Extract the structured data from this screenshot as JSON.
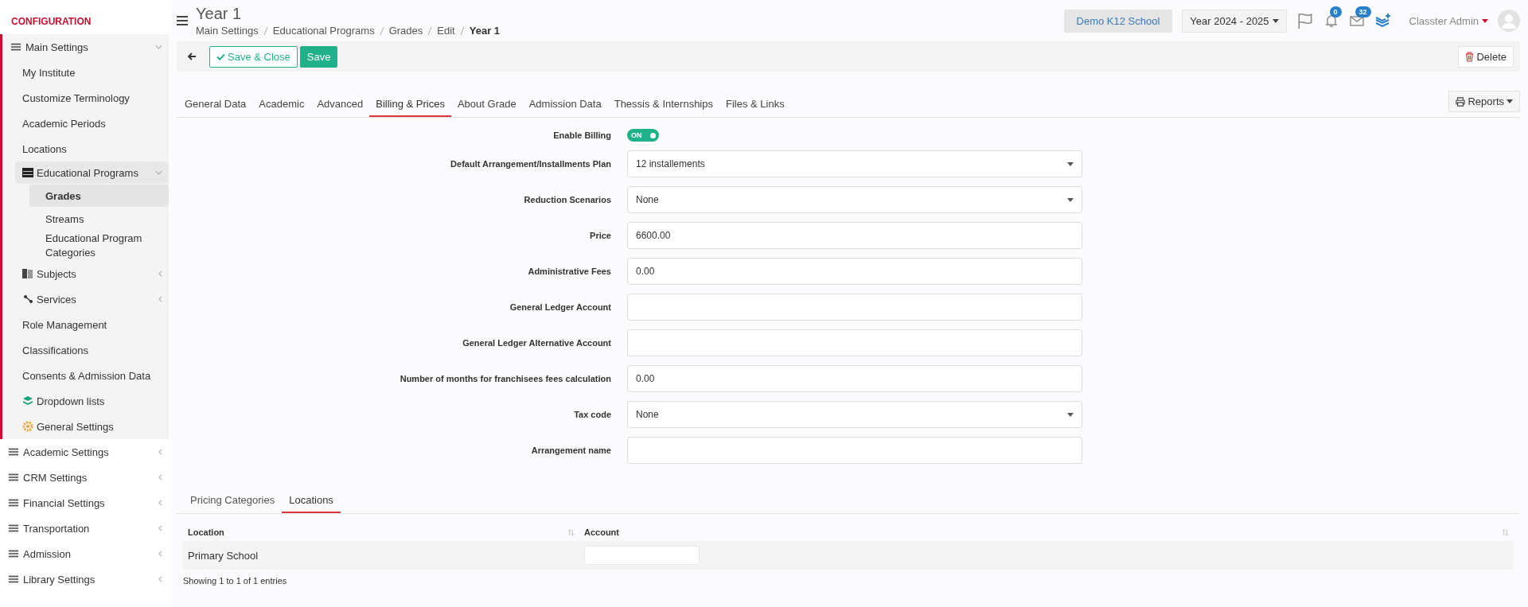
{
  "sidebar": {
    "heading": "CONFIGURATION",
    "items": [
      {
        "label": "Main Settings",
        "expanded": true,
        "selected": false,
        "children": [
          {
            "label": "My Institute",
            "selected": false
          },
          {
            "label": "Customize Terminology",
            "selected": false
          },
          {
            "label": "Academic Periods",
            "selected": false
          },
          {
            "label": "Locations",
            "selected": false
          },
          {
            "label": "Educational Programs",
            "expanded": true,
            "selected": false,
            "children": [
              {
                "label": "Grades",
                "selected": true
              },
              {
                "label": "Streams",
                "selected": false
              },
              {
                "label": "Educational Program Categories",
                "selected": false
              }
            ]
          },
          {
            "label": "Subjects",
            "expanded": false,
            "selected": false
          },
          {
            "label": "Services",
            "expanded": false,
            "selected": false
          },
          {
            "label": "Role Management",
            "selected": false
          },
          {
            "label": "Classifications",
            "selected": false
          },
          {
            "label": "Consents & Admission Data",
            "selected": false
          },
          {
            "label": "Dropdown lists",
            "selected": false
          },
          {
            "label": "General Settings",
            "selected": false
          }
        ]
      },
      {
        "label": "Academic Settings",
        "expanded": false,
        "selected": false
      },
      {
        "label": "CRM Settings",
        "expanded": false,
        "selected": false
      },
      {
        "label": "Financial Settings",
        "expanded": false,
        "selected": false
      },
      {
        "label": "Transportation",
        "expanded": false,
        "selected": false
      },
      {
        "label": "Admission",
        "expanded": false,
        "selected": false
      },
      {
        "label": "Library Settings",
        "expanded": false,
        "selected": false
      }
    ]
  },
  "header": {
    "title": "Year 1",
    "breadcrumbs": [
      "Main Settings",
      "Educational Programs",
      "Grades",
      "Edit",
      "Year 1"
    ],
    "school": "Demo K12 School",
    "year": "Year 2024 - 2025",
    "notifications": "0",
    "messages": "32",
    "user": "Classter Admin"
  },
  "toolbar": {
    "save_close": "Save & Close",
    "save": "Save",
    "delete": "Delete"
  },
  "tabs": [
    {
      "label": "General Data",
      "selected": false
    },
    {
      "label": "Academic",
      "selected": false
    },
    {
      "label": "Advanced",
      "selected": false
    },
    {
      "label": "Billing & Prices",
      "selected": true
    },
    {
      "label": "About Grade",
      "selected": false
    },
    {
      "label": "Admission Data",
      "selected": false
    },
    {
      "label": "Thessis & Internships",
      "selected": false
    },
    {
      "label": "Files & Links",
      "selected": false
    }
  ],
  "reports": "Reports",
  "form": [
    {
      "label": "Enable Billing",
      "kind": "toggle",
      "on": true,
      "value": "ON"
    },
    {
      "label": "Default Arrangement/Installments Plan",
      "kind": "select",
      "value": "12 installements"
    },
    {
      "label": "Reduction Scenarios",
      "kind": "select",
      "value": "None"
    },
    {
      "label": "Price",
      "kind": "text",
      "value": "6600.00"
    },
    {
      "label": "Administrative Fees",
      "kind": "text",
      "value": "0.00"
    },
    {
      "label": "General Ledger Account",
      "kind": "text"
    },
    {
      "label": "General Ledger Alternative Account",
      "kind": "text"
    },
    {
      "label": "Number of months for franchisees fees calculation",
      "kind": "text",
      "value": "0.00"
    },
    {
      "label": "Tax code",
      "kind": "select",
      "value": "None"
    },
    {
      "label": "Arrangement name",
      "kind": "text"
    }
  ],
  "sub_tabs": [
    {
      "label": "Pricing Categories",
      "selected": false
    },
    {
      "label": "Locations",
      "selected": true
    }
  ],
  "table": {
    "columns": [
      "Location",
      "Account"
    ],
    "rows": [
      {
        "location": "Primary School",
        "account_editable": true
      }
    ]
  },
  "table_info": "Showing 1 to 1 of 1 entries"
}
